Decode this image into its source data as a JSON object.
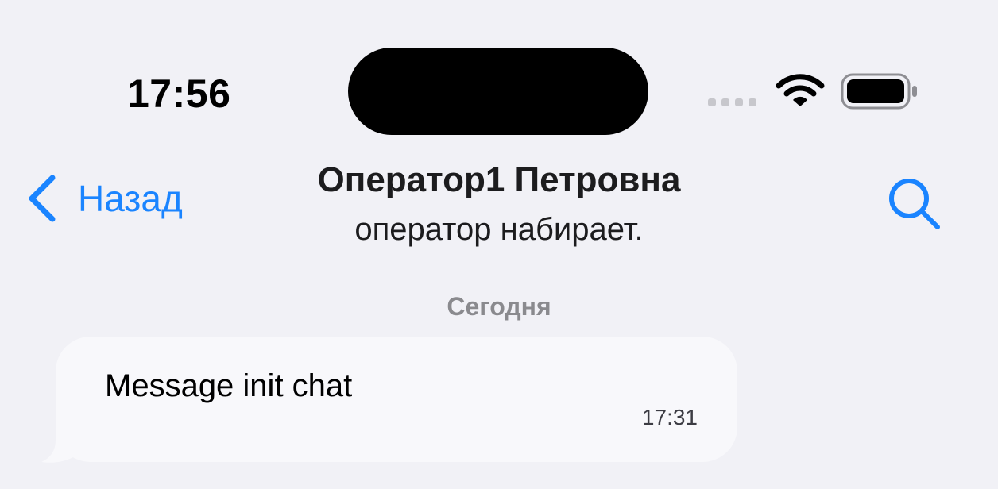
{
  "status_bar": {
    "time": "17:56",
    "signal_icon": "cellular-signal-icon",
    "wifi_icon": "wifi-icon",
    "battery_icon": "battery-icon"
  },
  "nav": {
    "back_icon": "chevron-left-icon",
    "back_label": "Назад",
    "title": "Оператор1 Петровна",
    "subtitle": "оператор набирает.",
    "search_icon": "search-icon",
    "accent_color": "#1a84ff"
  },
  "chat": {
    "date_label": "Сегодня",
    "messages": [
      {
        "text": "Message init chat",
        "time": "17:31",
        "direction": "incoming"
      }
    ]
  }
}
